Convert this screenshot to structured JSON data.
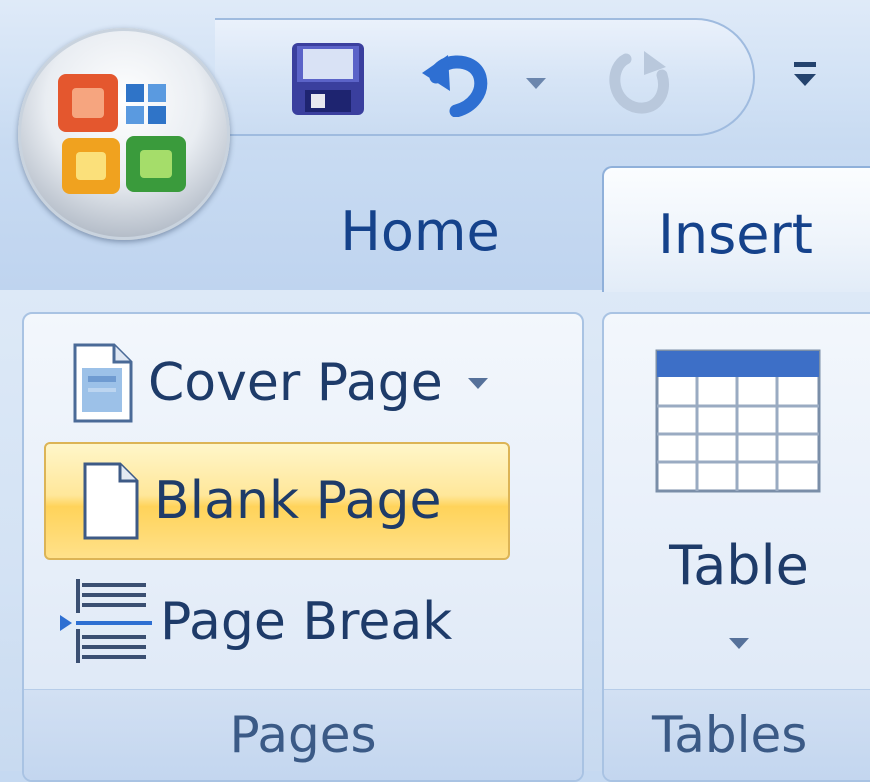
{
  "tabs": {
    "home": "Home",
    "insert": "Insert"
  },
  "groups": {
    "pages": {
      "label": "Pages",
      "cover_page": "Cover Page",
      "blank_page": "Blank Page",
      "page_break": "Page Break"
    },
    "tables": {
      "label": "Tables",
      "table": "Table"
    }
  },
  "icons": {
    "office_button": "office-logo-icon",
    "save": "floppy-disk-icon",
    "undo": "undo-icon",
    "redo": "redo-icon",
    "customize": "customize-qat-icon"
  },
  "colors": {
    "tab_text": "#15428b",
    "highlight": "#ffd35a"
  }
}
